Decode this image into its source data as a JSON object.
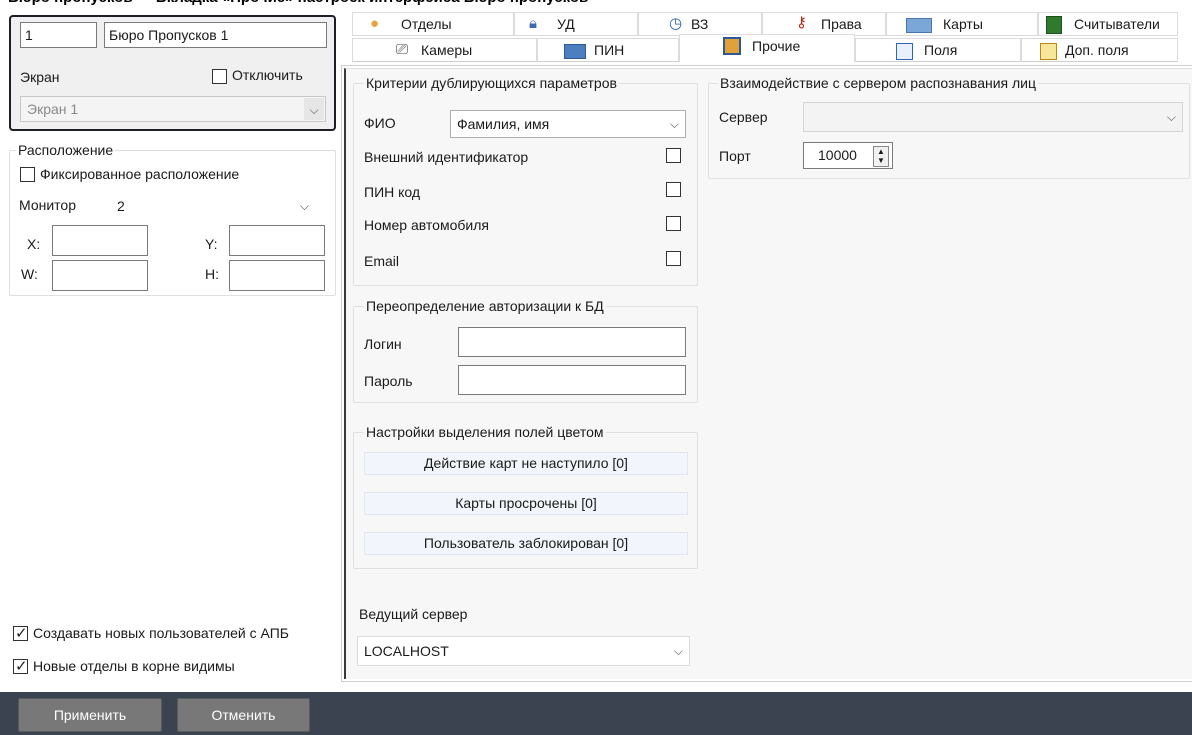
{
  "left": {
    "screen_number": "1",
    "name_value": "Бюро Пропусков 1",
    "screen_label": "Экран",
    "disable_label": "Отключить",
    "screen_select": "Экран 1",
    "location_legend": "Расположение",
    "fixed_label": "Фиксированное расположение",
    "monitor_label": "Монитор",
    "monitor_value": "2",
    "x_label": "X:",
    "y_label": "Y:",
    "w_label": "W:",
    "h_label": "H:",
    "create_apb_label": "Создавать новых пользователей с АПБ",
    "new_depts_label": "Новые отделы в корне видимы"
  },
  "tabs": {
    "row1": [
      "Отделы",
      "УД",
      "ВЗ",
      "Права",
      "Карты",
      "Считыватели"
    ],
    "row2": [
      "Камеры",
      "ПИН",
      "Прочие",
      "Поля",
      "Доп. поля"
    ]
  },
  "dup": {
    "legend": "Критерии дублирующихся параметров",
    "fio_label": "ФИО",
    "fio_value": "Фамилия, имя",
    "ext_id_label": "Внешний идентификатор",
    "pin_label": "ПИН код",
    "car_label": "Номер автомобиля",
    "email_label": "Email"
  },
  "auth": {
    "legend": "Переопределение авторизации к БД",
    "login_label": "Логин",
    "password_label": "Пароль"
  },
  "colors": {
    "legend": "Настройки выделения полей цветом",
    "not_started": "Действие карт не наступило [0]",
    "expired": "Карты просрочены [0]",
    "blocked": "Пользователь заблокирован [0]"
  },
  "lead": {
    "label": "Ведущий сервер",
    "value": "LOCALHOST"
  },
  "face": {
    "legend": "Взаимодействие с сервером распознавания лиц",
    "server_label": "Сервер",
    "server_value": "",
    "port_label": "Порт",
    "port_value": "10000"
  },
  "footer": {
    "apply": "Применить",
    "cancel": "Отменить"
  }
}
